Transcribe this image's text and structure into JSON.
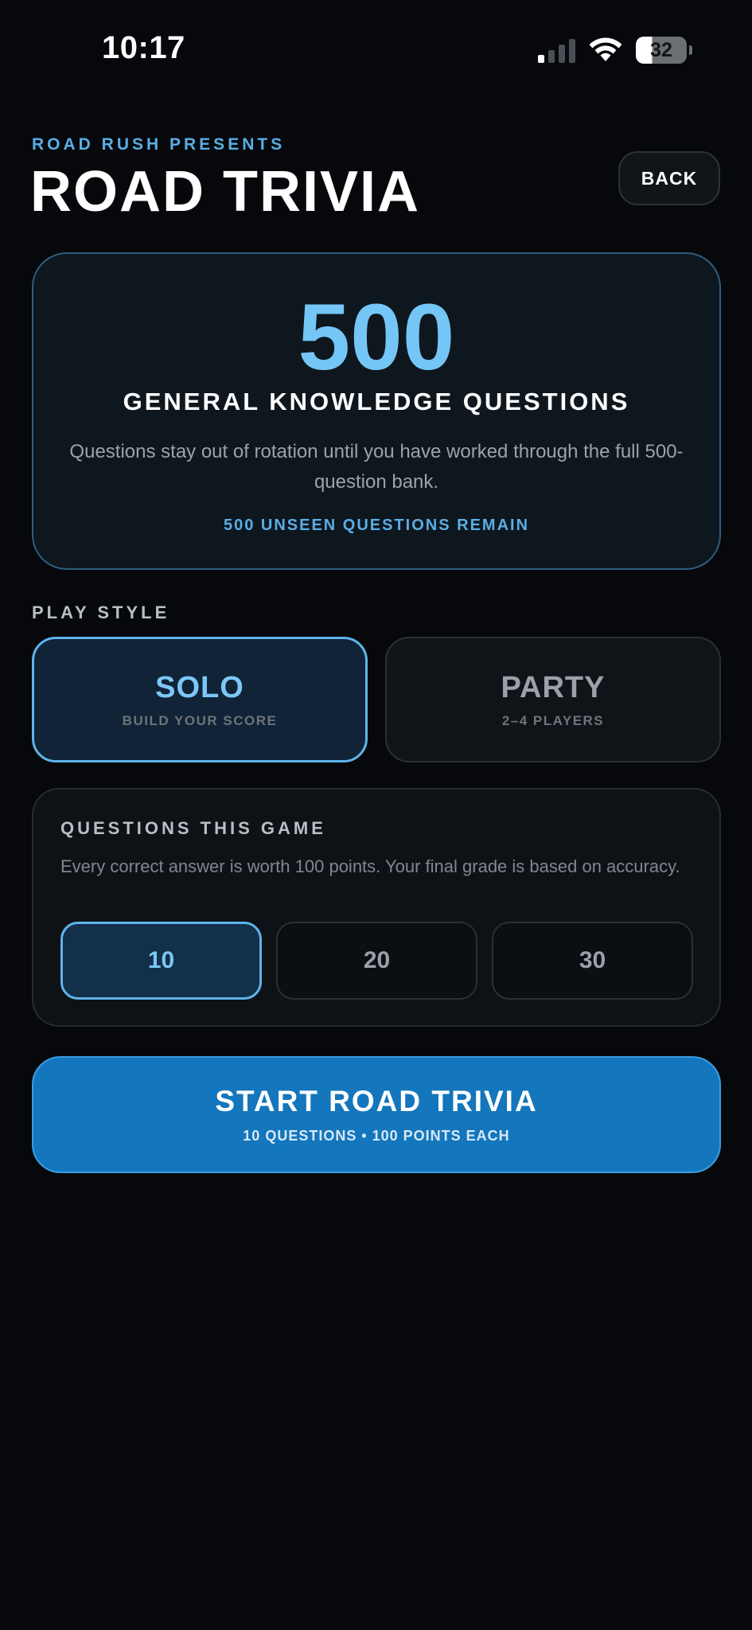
{
  "status_bar": {
    "time": "10:17",
    "battery": "32",
    "signal_bars_active": 1,
    "signal_bars_total": 4
  },
  "header": {
    "eyebrow": "ROAD RUSH PRESENTS",
    "title": "ROAD TRIVIA",
    "back_label": "BACK"
  },
  "hero": {
    "count": "500",
    "heading": "GENERAL KNOWLEDGE QUESTIONS",
    "description": "Questions stay out of rotation until you have worked through the full 500-question bank.",
    "remaining": "500 UNSEEN QUESTIONS REMAIN"
  },
  "play_style": {
    "label": "PLAY STYLE",
    "options": [
      {
        "title": "SOLO",
        "subtitle": "BUILD YOUR SCORE",
        "selected": true
      },
      {
        "title": "PARTY",
        "subtitle": "2–4 PLAYERS",
        "selected": false
      }
    ]
  },
  "questions_card": {
    "heading": "QUESTIONS THIS GAME",
    "note": "Every correct answer is worth 100 points. Your final grade is based on accuracy.",
    "options": [
      {
        "label": "10",
        "selected": true
      },
      {
        "label": "20",
        "selected": false
      },
      {
        "label": "30",
        "selected": false
      }
    ]
  },
  "start_button": {
    "title": "START ROAD TRIVIA",
    "subtitle": "10 QUESTIONS • 100 POINTS EACH"
  },
  "colors": {
    "background": "#06080b",
    "accent": "#74c6f6",
    "eyebrow": "#5aaee6",
    "start_button": "#1476bc"
  }
}
